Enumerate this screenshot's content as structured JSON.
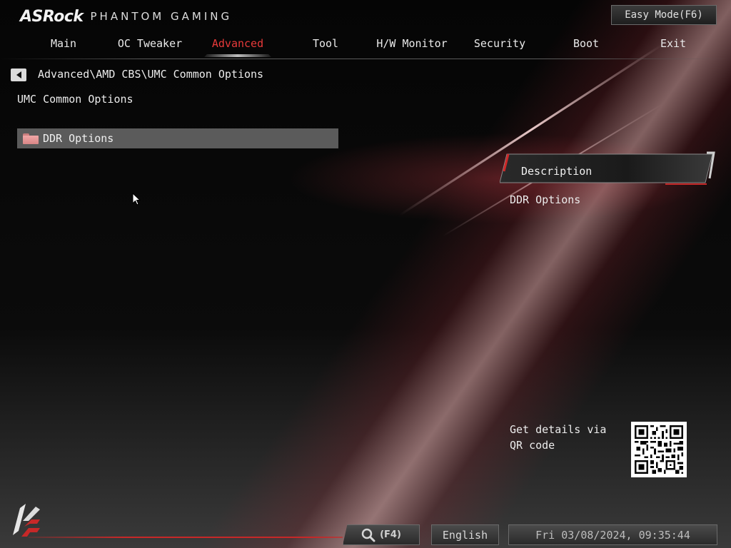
{
  "header": {
    "brand": "ASRock",
    "brand_sub": "PHANTOM GAMING",
    "easy_mode_label": "Easy Mode(F6)"
  },
  "nav": {
    "tabs": [
      {
        "label": "Main"
      },
      {
        "label": "OC Tweaker"
      },
      {
        "label": "Advanced",
        "active": true
      },
      {
        "label": "Tool"
      },
      {
        "label": "H/W Monitor"
      },
      {
        "label": "Security"
      },
      {
        "label": "Boot"
      },
      {
        "label": "Exit"
      }
    ]
  },
  "breadcrumb": "Advanced\\AMD CBS\\UMC Common Options",
  "page_title": "UMC Common Options",
  "menu": {
    "items": [
      {
        "label": "DDR Options",
        "icon": "folder-icon",
        "selected": true
      }
    ]
  },
  "description": {
    "title": "Description",
    "text": "DDR Options"
  },
  "qr": {
    "text": "Get details via QR code"
  },
  "footer": {
    "search_key": "(F4)",
    "language": "English",
    "datetime": "Fri 03/08/2024, 09:35:44"
  },
  "colors": {
    "accent": "#e83a3a",
    "selected_row": "#5b5b5b",
    "folder": "#f0a6a6"
  }
}
